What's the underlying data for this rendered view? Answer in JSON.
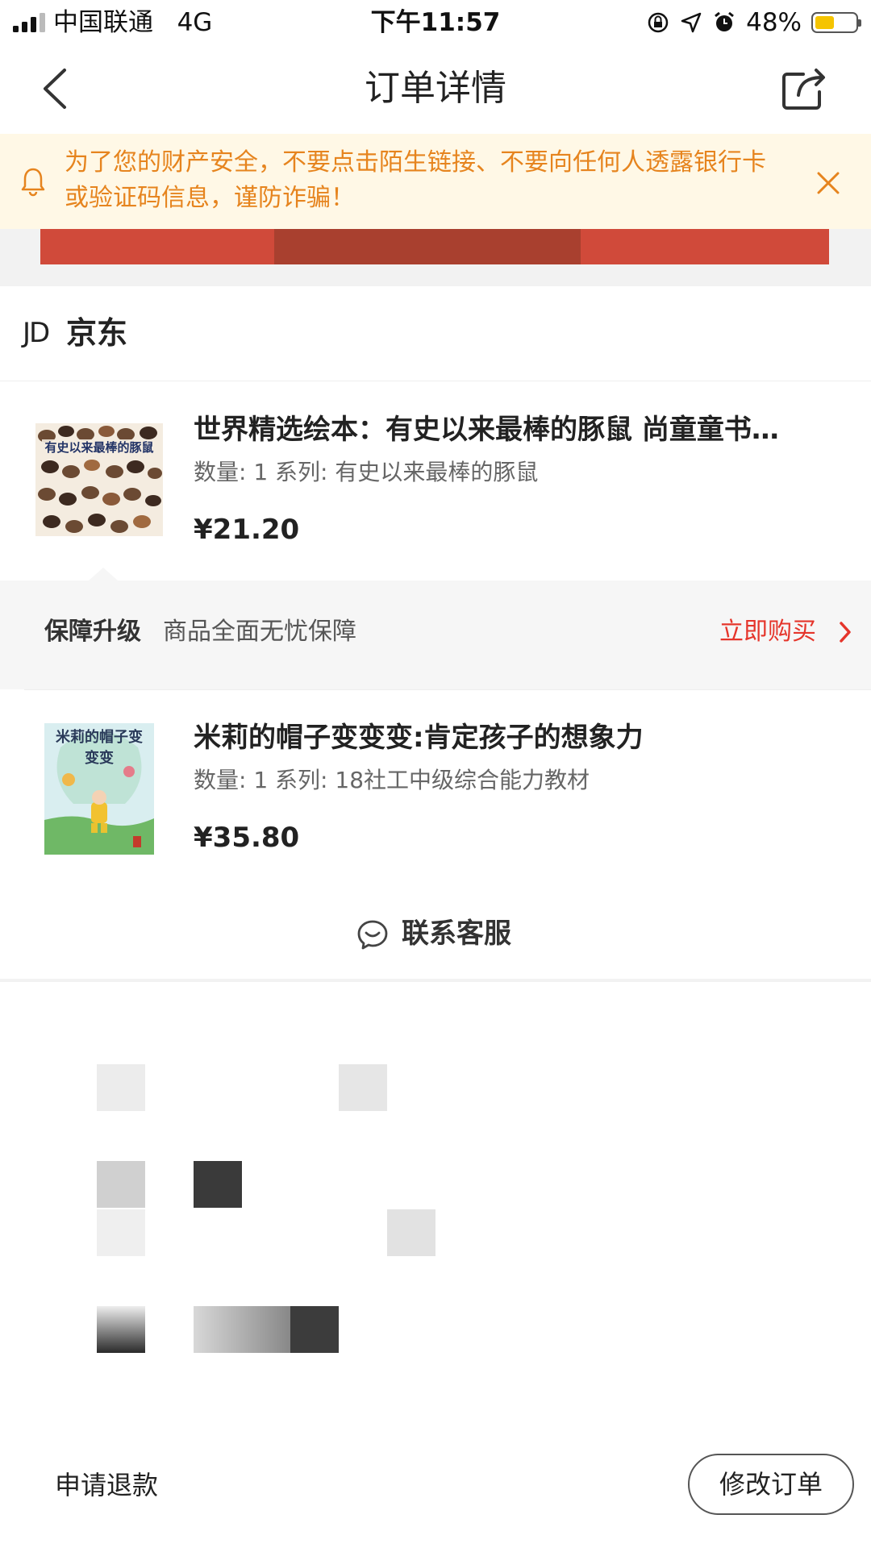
{
  "status_bar": {
    "carrier": "中国联通",
    "network": "4G",
    "time": "下午11:57",
    "battery": "48%",
    "battery_level": 0.48
  },
  "nav": {
    "title": "订单详情",
    "back_icon": "chevron-left-icon",
    "share_icon": "share-icon"
  },
  "notice": {
    "text_line1": "为了您的财产安全，不要点击陌生链接、不要向任何人透露银行卡",
    "text_line2": "或验证码信息，谨防诈骗！",
    "bell_icon": "bell-icon",
    "close_icon": "close-icon",
    "color": "#e6841e"
  },
  "shop": {
    "logo": "JD",
    "name": "京东"
  },
  "products": [
    {
      "title": "世界精选绘本：有史以来最棒的豚鼠 尚童童书…",
      "meta": "数量: 1 系列: 有史以来最棒的豚鼠",
      "price": "¥21.20",
      "cover_text": "有史以来最棒的豚鼠"
    },
    {
      "title": "米莉的帽子变变变:肯定孩子的想象力",
      "meta": "数量: 1 系列: 18社工中级综合能力教材",
      "price": "¥35.80",
      "cover_text": "米莉的帽子变变变"
    }
  ],
  "guarantee": {
    "label": "保障升级",
    "desc": "商品全面无忧保障",
    "buy": "立即购买",
    "accent": "#e5352b"
  },
  "customer_service": {
    "label": "联系客服",
    "icon": "chat-smile-icon"
  },
  "footer": {
    "refund": "申请退款",
    "modify": "修改订单"
  }
}
